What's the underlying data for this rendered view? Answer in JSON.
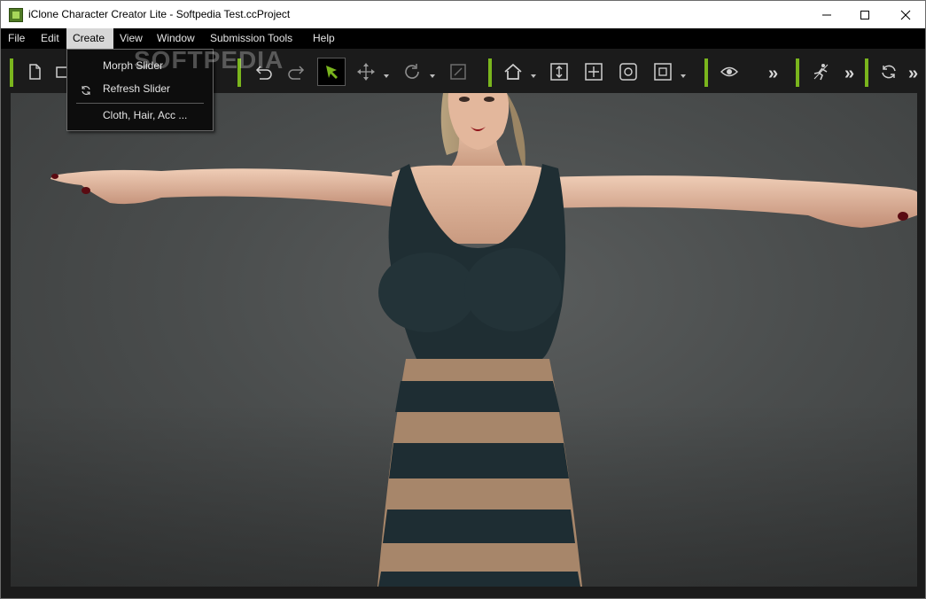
{
  "window": {
    "title": "iClone Character Creator Lite - Softpedia Test.ccProject",
    "minimize_icon": "minimize-icon",
    "maximize_icon": "maximize-icon",
    "close_icon": "close-icon"
  },
  "menubar": {
    "items": [
      {
        "label": "File"
      },
      {
        "label": "Edit"
      },
      {
        "label": "Create",
        "active": true
      },
      {
        "label": "View"
      },
      {
        "label": "Window"
      },
      {
        "label": "Submission Tools"
      },
      {
        "label": "Help"
      }
    ]
  },
  "create_menu": {
    "items": [
      {
        "label": "Morph Slider"
      },
      {
        "label": "Refresh Slider",
        "icon": "refresh-icon"
      },
      {
        "label": "Cloth, Hair, Acc ..."
      }
    ]
  },
  "toolbar": {
    "accent_color": "#7ab51d",
    "overflow_label": "»",
    "icons": [
      "new-file-icon",
      "open-icon",
      "undo-icon",
      "redo-icon",
      "select-arrow-icon",
      "move-icon",
      "rotate-icon",
      "scale-icon",
      "home-camera-icon",
      "fit-vertical-icon",
      "fit-all-icon",
      "orbit-icon",
      "zoom-extents-icon",
      "visibility-eye-icon",
      "pose-icon",
      "sync-icon"
    ]
  },
  "watermark": "SOFTPEDIA",
  "colors": {
    "menubar_bg": "#000000",
    "viewport_bg": "#4a4d4d",
    "dress_dark": "#1e2d33",
    "dress_stripe": "#a4846a",
    "skin": "#e0b49a"
  }
}
